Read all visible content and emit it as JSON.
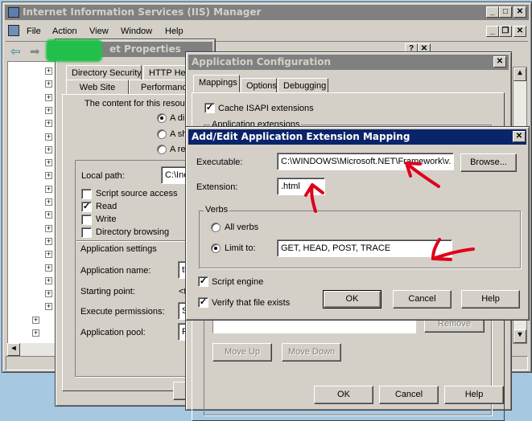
{
  "iis": {
    "title": "Internet Information Services (IIS) Manager",
    "menu": [
      "File",
      "Action",
      "View",
      "Window",
      "Help"
    ]
  },
  "props": {
    "title": "et Properties",
    "tabs_row1": [
      "Directory Security",
      "HTTP He"
    ],
    "tabs_row2": [
      "Web Site",
      "Performance"
    ],
    "content_label": "The content for this resour",
    "radios": [
      "A di",
      "A sh",
      "A re"
    ],
    "local_path_label": "Local path:",
    "local_path_value": "C:\\Ine",
    "checks": [
      {
        "label": "Script source access",
        "checked": false
      },
      {
        "label": "Read",
        "checked": true
      },
      {
        "label": "Write",
        "checked": false
      },
      {
        "label": "Directory browsing",
        "checked": false
      }
    ],
    "app_settings": "Application settings",
    "app_name_label": "Application name:",
    "app_name_value": "th",
    "starting_point_label": "Starting point:",
    "starting_point_value": "<t",
    "exec_perm_label": "Execute permissions:",
    "exec_perm_value": "S",
    "app_pool_label": "Application pool:",
    "app_pool_value": "P"
  },
  "appconfig": {
    "title": "Application Configuration",
    "tabs": [
      "Mappings",
      "Options",
      "Debugging"
    ],
    "cache_isapi": "Cache ISAPI extensions",
    "app_ext_group": "Application extensions",
    "remove": "Remove",
    "move_up": "Move Up",
    "move_down": "Move Down",
    "ok": "OK",
    "cancel": "Cancel",
    "help": "Help"
  },
  "mapping": {
    "title": "Add/Edit Application Extension Mapping",
    "executable_label": "Executable:",
    "executable_value": "C:\\WINDOWS\\Microsoft.NET\\Framework\\v.",
    "browse": "Browse...",
    "extension_label": "Extension:",
    "extension_value": ".html",
    "verbs_group": "Verbs",
    "all_verbs": "All verbs",
    "limit_to": "Limit to:",
    "limit_value": "GET, HEAD, POST, TRACE",
    "script_engine": "Script engine",
    "verify_file": "Verify that file exists",
    "ok": "OK",
    "cancel": "Cancel",
    "help": "Help",
    "selected_verb_option": "Limit to",
    "script_engine_checked": true,
    "verify_checked": true
  },
  "colors": {
    "active_title": "#0a246a",
    "inactive_title": "#808080",
    "annotation": "#e0001a",
    "redaction": "#22c04a",
    "desktop": "#a6c8e0"
  }
}
